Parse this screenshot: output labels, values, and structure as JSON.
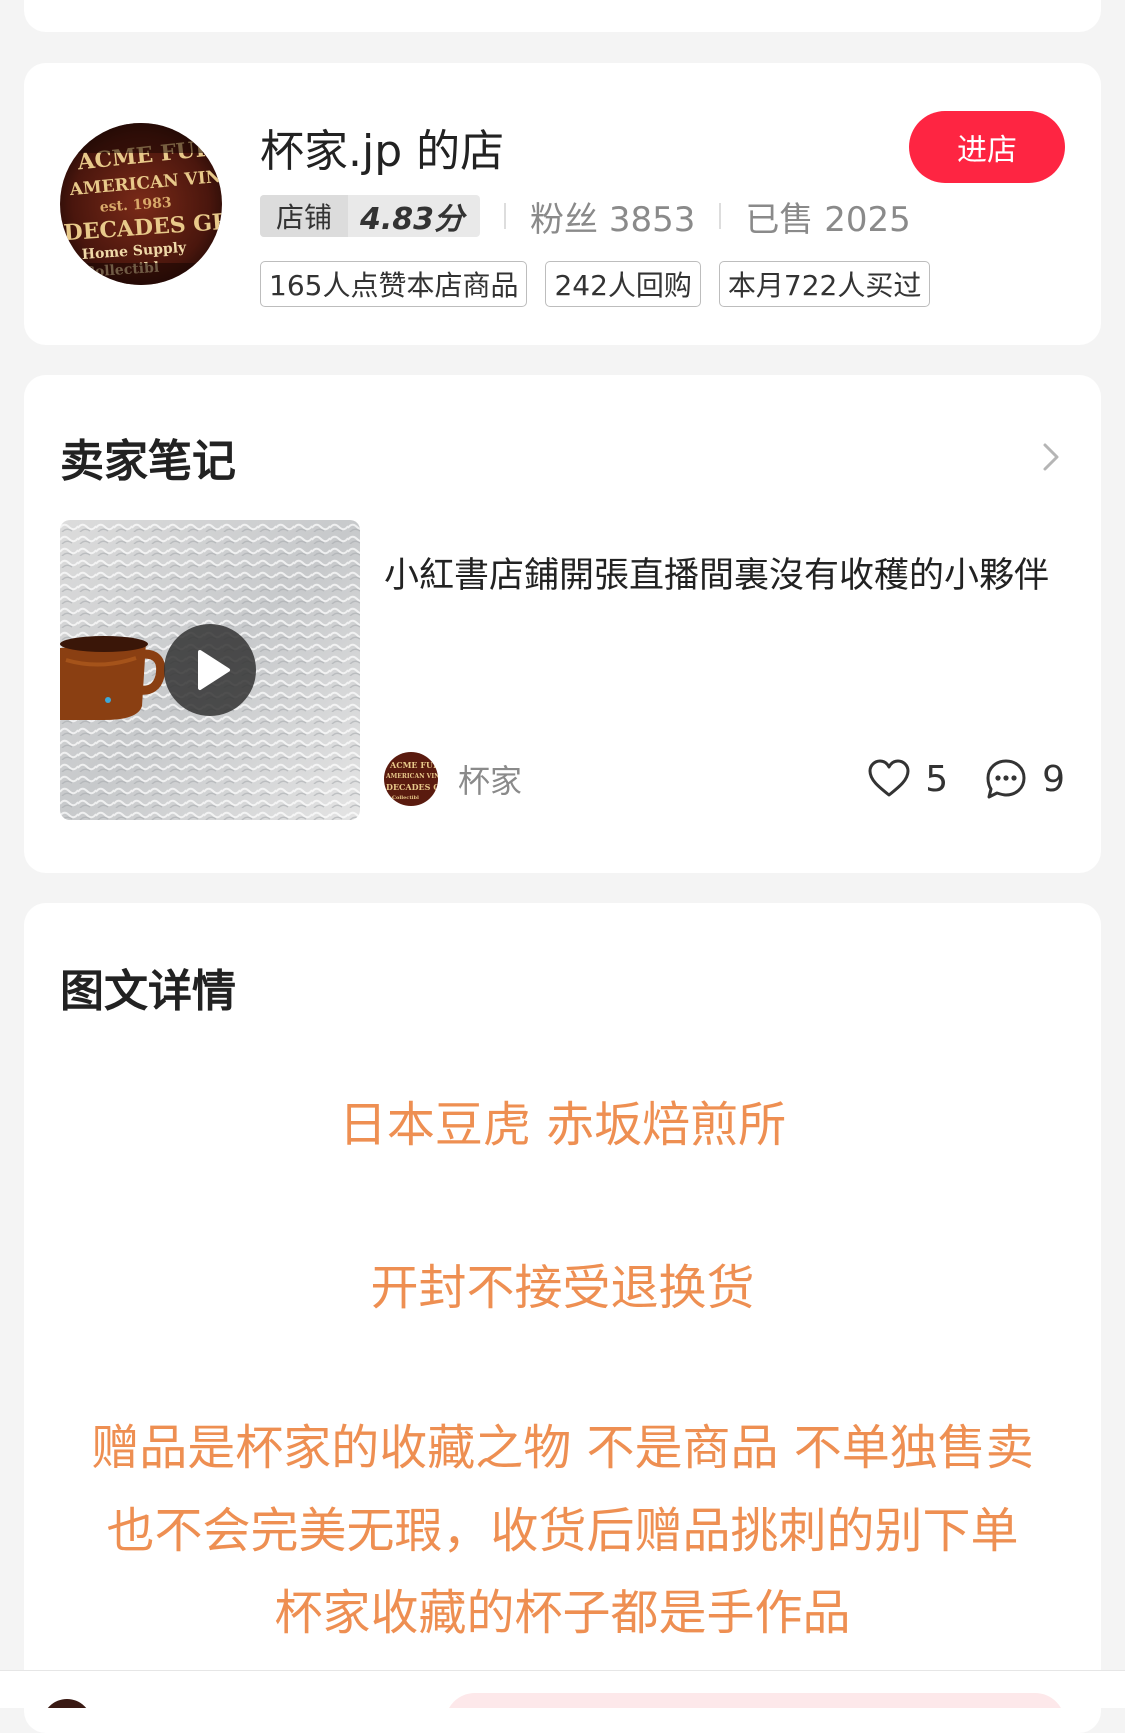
{
  "shop": {
    "name": "杯家.jp 的店",
    "enter_label": "进店",
    "rating_label": "店铺",
    "rating_value": "4.83分",
    "fans": "粉丝 3853",
    "sold": "已售 2025",
    "tags": [
      "165人点赞本店商品",
      "242人回购",
      "本月722人买过"
    ],
    "avatar_icon": "vintage-sign-logo"
  },
  "notes": {
    "title": "卖家笔记",
    "item": {
      "text": "小紅書店鋪開張直播間裏沒有收穫的小夥伴",
      "author": "杯家",
      "likes": "5",
      "comments": "9"
    }
  },
  "detail": {
    "title": "图文详情",
    "lines": [
      "日本豆虎  赤坂焙煎所",
      "开封不接受退换货",
      "赠品是杯家的收藏之物  不是商品  不单独售卖",
      "也不会完美无瑕，收货后赠品挑刺的别下单",
      "杯家收藏的杯子都是手作品"
    ]
  },
  "colors": {
    "accent": "#fe2542",
    "detail_text": "#ee8f52",
    "background": "#f4f4f4"
  }
}
